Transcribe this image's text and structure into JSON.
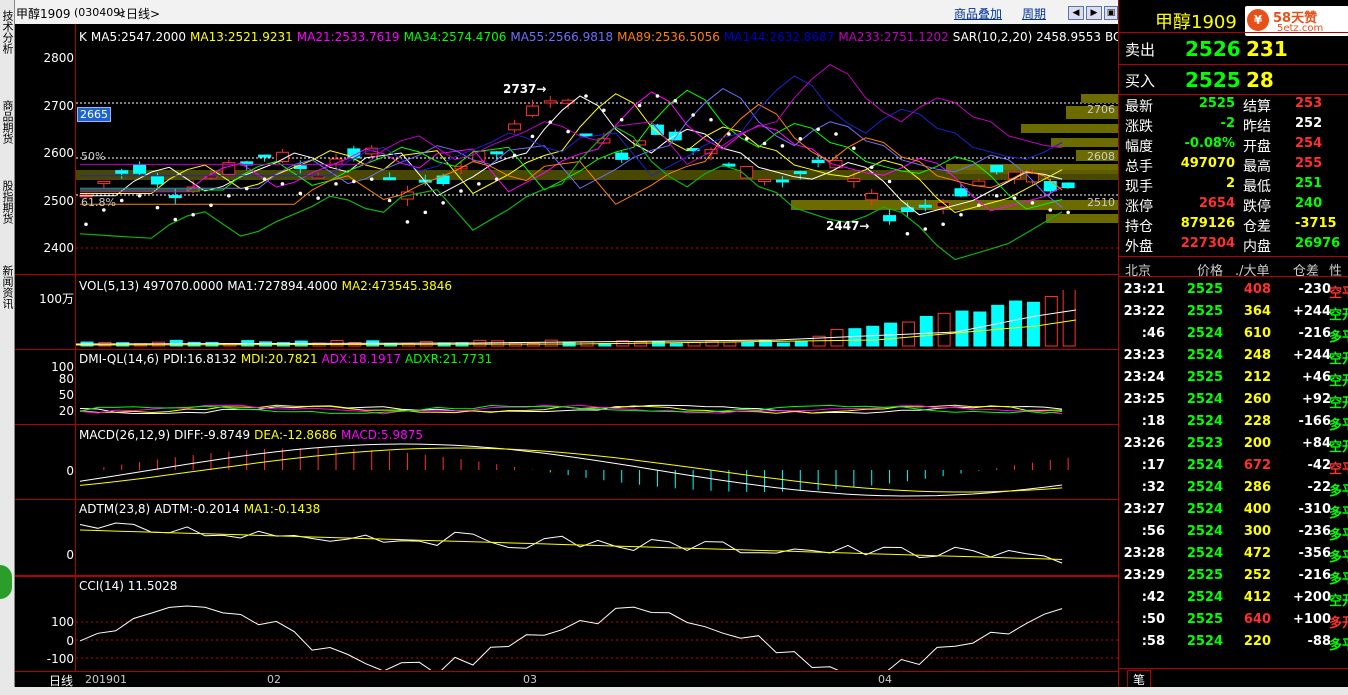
{
  "title": {
    "name": "甲醇1909",
    "code": "(030409)",
    "period": "<日线>",
    "buttons": [
      "商品叠加",
      "周期"
    ]
  },
  "left_tabs": [
    "技术分析",
    "商品期货",
    "股指期货",
    "新闻资讯"
  ],
  "main_indicators": [
    {
      "text": "K",
      "color": "#ffffff"
    },
    {
      "text": "MA5:2547.2000",
      "color": "#ffffff"
    },
    {
      "text": "MA13:2521.9231",
      "color": "#ffff00"
    },
    {
      "text": "MA21:2533.7619",
      "color": "#ff00ff"
    },
    {
      "text": "MA34:2574.4706",
      "color": "#00ff00"
    },
    {
      "text": "MA55:2566.9818",
      "color": "#6f6fff"
    },
    {
      "text": "MA89:2536.5056",
      "color": "#ff8000"
    },
    {
      "text": "MA144:2632.8687",
      "color": "#0000cc"
    },
    {
      "text": "MA233:2751.1202",
      "color": "#c000c0"
    },
    {
      "text": "SAR(10,2,20) 2458.9553",
      "color": "#ffffff"
    },
    {
      "text": "BOLL(26,2) M",
      "color": "#ffffff"
    }
  ],
  "price_axis": [
    "2800",
    "2700",
    "2600",
    "2500",
    "2400"
  ],
  "price_annotations": {
    "high": "2737",
    "low": "2447",
    "level_2665": "2665",
    "pct50": "50%",
    "pct618": "61.8%",
    "side_2706": "2706",
    "side_2608": "2608",
    "side_2510": "2510"
  },
  "vol_header": {
    "name": "VOL(5,13) 497070.0000",
    "ma1": "MA1:727894.4000",
    "ma2": "MA2:473545.3846"
  },
  "vol_axis": "100万",
  "dmi_header": {
    "name": "DMI-QL(14,6)",
    "pdi": "PDI:16.8132",
    "mdi": "MDI:20.7821",
    "adx": "ADX:18.1917",
    "adxr": "ADXR:21.7731"
  },
  "dmi_axis": [
    "100",
    "80",
    "50",
    "20"
  ],
  "macd_header": {
    "name": "MACD(26,12,9)",
    "diff": "DIFF:-9.8749",
    "dea": "DEA:-12.8686",
    "macd": "MACD:5.9875"
  },
  "macd_axis": "0",
  "adtm_header": {
    "name": "ADTM(23,8)",
    "adtm": "ADTM:-0.2014",
    "ma1": "MA1:-0.1438"
  },
  "adtm_axis": "0",
  "cci_header": {
    "name": "CCI(14) 11.5028"
  },
  "cci_axis": [
    "100",
    "0",
    "-100"
  ],
  "date_axis": {
    "label": "日线",
    "ticks": [
      "201901",
      "02",
      "03",
      "04"
    ]
  },
  "quote_panel": {
    "name": "甲醇1909",
    "sell_label": "卖出",
    "sell_price": "2526",
    "sell_vol": "231",
    "buy_label": "买入",
    "buy_price": "2525",
    "buy_vol": "28",
    "rows": [
      {
        "l": "最新",
        "lv": "2525",
        "lc": "#00ff00",
        "r": "结算",
        "rv": "253",
        "rc": "#ff3030"
      },
      {
        "l": "涨跌",
        "lv": "-2",
        "lc": "#00ff00",
        "r": "昨结",
        "rv": "252",
        "rc": "#ffffff"
      },
      {
        "l": "幅度",
        "lv": "-0.08%",
        "lc": "#00ff00",
        "r": "开盘",
        "rv": "254",
        "rc": "#ff3030"
      },
      {
        "l": "总手",
        "lv": "497070",
        "lc": "#ffff00",
        "r": "最高",
        "rv": "255",
        "rc": "#ff3030"
      },
      {
        "l": "现手",
        "lv": "2",
        "lc": "#ffff00",
        "r": "最低",
        "rv": "251",
        "rc": "#00ff00"
      },
      {
        "l": "涨停",
        "lv": "2654",
        "lc": "#ff3030",
        "r": "跌停",
        "rv": "240",
        "rc": "#00ff00"
      },
      {
        "l": "持仓",
        "lv": "879126",
        "lc": "#ffff00",
        "r": "仓差",
        "rv": "-3715",
        "rc": "#ffff00"
      },
      {
        "l": "外盘",
        "lv": "227304",
        "lc": "#ff3030",
        "r": "内盘",
        "rv": "26976",
        "rc": "#00ff00"
      }
    ],
    "tick_header": [
      "北京",
      "价格",
      "./大单",
      "仓差",
      "性"
    ],
    "ticks": [
      {
        "t": "23:21",
        "p": "2525",
        "v": "408",
        "vc": "#ff3030",
        "d": "-230",
        "k": "空平",
        "kc": "#ff3030"
      },
      {
        "t": "23:22",
        "p": "2525",
        "v": "364",
        "vc": "#ffff00",
        "d": "+244",
        "k": "空开",
        "kc": "#00ff00"
      },
      {
        "t": ":46",
        "p": "2524",
        "v": "610",
        "vc": "#ffff00",
        "d": "-216",
        "k": "多平",
        "kc": "#00ff00"
      },
      {
        "t": "23:23",
        "p": "2524",
        "v": "248",
        "vc": "#ffff00",
        "d": "+244",
        "k": "空开",
        "kc": "#00ff00"
      },
      {
        "t": "23:24",
        "p": "2525",
        "v": "212",
        "vc": "#ffff00",
        "d": "+46",
        "k": "空开",
        "kc": "#00ff00"
      },
      {
        "t": "23:25",
        "p": "2524",
        "v": "260",
        "vc": "#ffff00",
        "d": "+92",
        "k": "空开",
        "kc": "#00ff00"
      },
      {
        "t": ":18",
        "p": "2524",
        "v": "228",
        "vc": "#ffff00",
        "d": "-166",
        "k": "多平",
        "kc": "#00ff00"
      },
      {
        "t": "23:26",
        "p": "2523",
        "v": "200",
        "vc": "#ffff00",
        "d": "+84",
        "k": "空开",
        "kc": "#00ff00"
      },
      {
        "t": ":17",
        "p": "2524",
        "v": "672",
        "vc": "#ff3030",
        "d": "-42",
        "k": "空平",
        "kc": "#ff3030"
      },
      {
        "t": ":32",
        "p": "2524",
        "v": "286",
        "vc": "#ffff00",
        "d": "-22",
        "k": "多平",
        "kc": "#00ff00"
      },
      {
        "t": "23:27",
        "p": "2524",
        "v": "400",
        "vc": "#ffff00",
        "d": "-310",
        "k": "多平",
        "kc": "#00ff00"
      },
      {
        "t": ":56",
        "p": "2524",
        "v": "300",
        "vc": "#ffff00",
        "d": "-236",
        "k": "多平",
        "kc": "#00ff00"
      },
      {
        "t": "23:28",
        "p": "2524",
        "v": "472",
        "vc": "#ffff00",
        "d": "-356",
        "k": "多平",
        "kc": "#00ff00"
      },
      {
        "t": "23:29",
        "p": "2525",
        "v": "252",
        "vc": "#ffff00",
        "d": "-216",
        "k": "多平",
        "kc": "#00ff00"
      },
      {
        "t": ":42",
        "p": "2524",
        "v": "412",
        "vc": "#ffff00",
        "d": "+200",
        "k": "空开",
        "kc": "#00ff00"
      },
      {
        "t": ":50",
        "p": "2525",
        "v": "640",
        "vc": "#ff3030",
        "d": "+100",
        "k": "多开",
        "kc": "#ff3030"
      },
      {
        "t": ":58",
        "p": "2524",
        "v": "220",
        "vc": "#ffff00",
        "d": "-88",
        "k": "多平",
        "kc": "#00ff00"
      }
    ],
    "bottom_tab": "笔"
  },
  "watermark": "58 天赞 5etz.com"
}
